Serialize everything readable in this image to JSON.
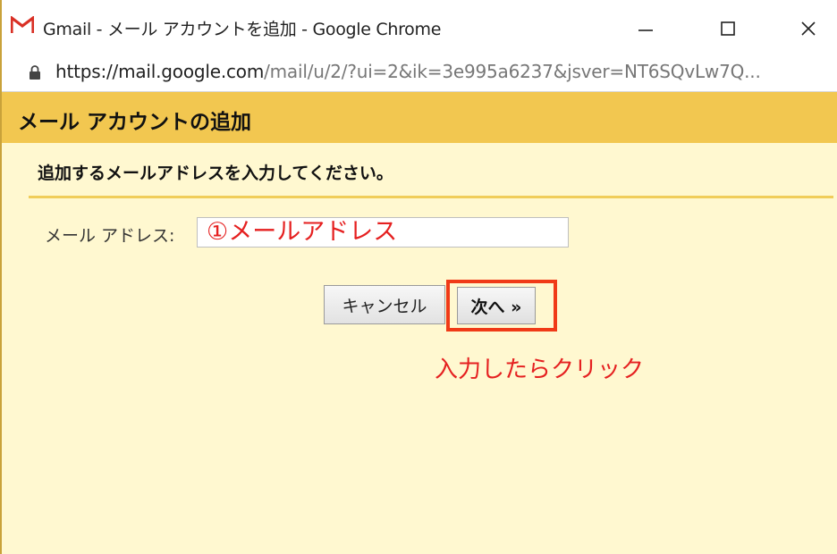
{
  "window": {
    "title": "Gmail - メール アカウントを追加 - Google Chrome",
    "controls": {
      "minimize_icon": "minimize-icon",
      "maximize_icon": "maximize-icon",
      "close_icon": "close-icon"
    }
  },
  "addressbar": {
    "url_host": "https://mail.google.com",
    "url_path": "/mail/u/2/?ui=2&ik=3e995a6237&jsver=NT6SQvLw7Q..."
  },
  "dialog": {
    "title": "メール アカウントの追加",
    "instruction": "追加するメールアドレスを入力してください。",
    "email_label": "メール アドレス:",
    "email_value": "①メールアドレス",
    "cancel_label": "キャンセル",
    "next_label": "次へ »"
  },
  "annotation": {
    "callout": "入力したらクリック"
  },
  "colors": {
    "header_bg": "#f2c750",
    "page_bg": "#fff8d0",
    "annotation_red": "#e52020",
    "highlight_border": "#f03a17"
  }
}
